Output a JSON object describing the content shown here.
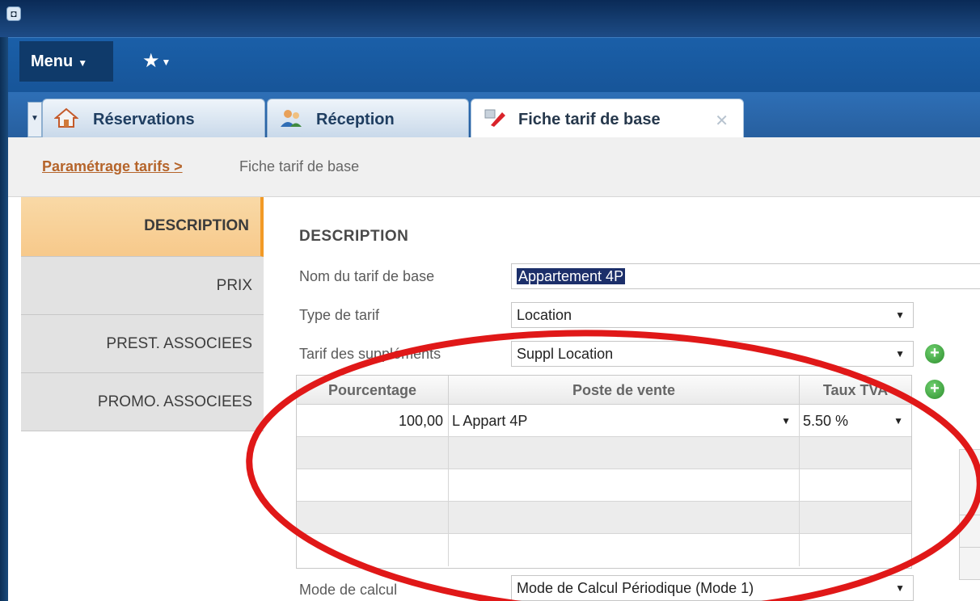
{
  "window": {
    "app_icon": "app-logo-icon"
  },
  "menu": {
    "menu_label": "Menu",
    "favorites_icon": "star-icon"
  },
  "tabs": [
    {
      "label": "Réservations",
      "icon": "house-icon"
    },
    {
      "label": "Réception",
      "icon": "people-icon"
    },
    {
      "label": "Fiche tarif de base",
      "icon": "pencil-icon",
      "close_icon": "close-icon"
    }
  ],
  "breadcrumb": {
    "link": "Paramétrage tarifs >",
    "current": "Fiche tarif de base"
  },
  "sidebar": {
    "items": [
      {
        "label": "DESCRIPTION",
        "active": true
      },
      {
        "label": "PRIX"
      },
      {
        "label": "PREST. ASSOCIEES"
      },
      {
        "label": "PROMO. ASSOCIEES"
      }
    ]
  },
  "form": {
    "section_title": "DESCRIPTION",
    "name_label": "Nom du tarif de base",
    "name_value": "Appartement 4P",
    "type_label": "Type de tarif",
    "type_value": "Location",
    "supp_label": "Tarif des suppléments",
    "supp_value": "Suppl Location",
    "calc_label": "Mode de calcul",
    "calc_value": "Mode de Calcul Périodique (Mode 1)"
  },
  "grid": {
    "headers": {
      "pct": "Pourcentage",
      "poste": "Poste de vente",
      "tva": "Taux TVA"
    },
    "rows": [
      {
        "pct": "100,00",
        "poste": "L Appart 4P",
        "tva": "5.50 %"
      },
      {
        "pct": "",
        "poste": "",
        "tva": ""
      },
      {
        "pct": "",
        "poste": "",
        "tva": ""
      },
      {
        "pct": "",
        "poste": "",
        "tva": ""
      },
      {
        "pct": "",
        "poste": "",
        "tva": ""
      }
    ]
  },
  "colors": {
    "accent_orange": "#f29a26",
    "title_bar": "#0a2a56",
    "menu_bar": "#1a5fa8",
    "annotation": "#e01818"
  }
}
